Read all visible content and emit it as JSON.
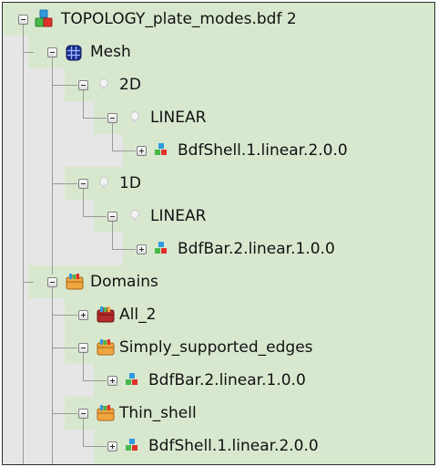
{
  "tree": {
    "root": {
      "label": "TOPOLOGY_plate_modes.bdf 2",
      "icon": "colored-blocks-icon"
    },
    "mesh": {
      "label": "Mesh",
      "icon": "mesh-grid-icon"
    },
    "mesh_2d": {
      "label": "2D",
      "icon": "bulb-icon"
    },
    "mesh_2d_linear": {
      "label": "LINEAR",
      "icon": "bulb-icon"
    },
    "mesh_2d_linear_item": {
      "label": "BdfShell.1.linear.2.0.0",
      "icon": "mini-blocks-icon"
    },
    "mesh_1d": {
      "label": "1D",
      "icon": "bulb-icon"
    },
    "mesh_1d_linear": {
      "label": "LINEAR",
      "icon": "bulb-icon"
    },
    "mesh_1d_linear_item": {
      "label": "BdfBar.2.linear.1.0.0",
      "icon": "mini-blocks-icon"
    },
    "domains": {
      "label": "Domains",
      "icon": "toolbox-icon"
    },
    "domain_all": {
      "label": "All_2",
      "icon": "toolbox-red-icon"
    },
    "domain_simply": {
      "label": "Simply_supported_edges",
      "icon": "toolbox-icon"
    },
    "domain_simply_item": {
      "label": "BdfBar.2.linear.1.0.0",
      "icon": "mini-blocks-icon"
    },
    "domain_thin": {
      "label": "Thin_shell",
      "icon": "toolbox-icon"
    },
    "domain_thin_item": {
      "label": "BdfShell.1.linear.2.0.0",
      "icon": "mini-blocks-icon"
    }
  },
  "colors": {
    "row_highlight": "#d8e8cf",
    "row_indent": "#e6e6e6",
    "tree_line": "#9a9a9a",
    "border": "#2b2b2b"
  }
}
